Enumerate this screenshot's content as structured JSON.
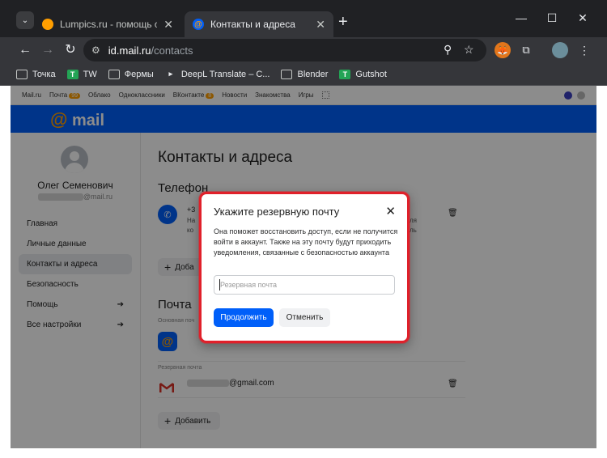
{
  "browser": {
    "tabs": [
      {
        "title": "Lumpics.ru - помощь с компь",
        "active": false
      },
      {
        "title": "Контакты и адреса",
        "active": true
      }
    ],
    "url_host": "id.mail.ru",
    "url_path": "/contacts",
    "bookmarks": [
      "Точка",
      "TW",
      "Фермы",
      "DeepL Translate – С...",
      "Blender",
      "Gutshot"
    ]
  },
  "portal_bar": {
    "items": [
      "Mail.ru",
      "Почта",
      "Облако",
      "Одноклассники",
      "ВКонтакте",
      "Новости",
      "Знакомства",
      "Игры"
    ],
    "mail_badge": "99",
    "vk_badge": "8"
  },
  "header": {
    "logo_at": "@",
    "logo_text": "mail"
  },
  "sidebar": {
    "user_name": "Олег Семенович",
    "user_email_suffix": "@mail.ru",
    "items": [
      {
        "label": "Главная",
        "active": false
      },
      {
        "label": "Личные данные",
        "active": false
      },
      {
        "label": "Контакты и адреса",
        "active": true
      },
      {
        "label": "Безопасность",
        "active": false
      },
      {
        "label": "Помощь",
        "active": false,
        "arrow": "➔"
      },
      {
        "label": "Все настройки",
        "active": false,
        "arrow": "➔"
      }
    ]
  },
  "main": {
    "title": "Контакты и адреса",
    "phone_section": "Телефон",
    "phone_prefix": "+3",
    "phone_line1": "На",
    "phone_line2": "ко",
    "phone_right1": "ля",
    "phone_right2": "ль",
    "add_label": "Добавить",
    "add_label_cut": "Доба",
    "mail_section": "Почта",
    "primary_label": "Основная поч",
    "backup_label": "Резервная почта",
    "backup_email_suffix": "@gmail.com"
  },
  "dialog": {
    "title": "Укажите резервную почту",
    "close": "✕",
    "text": "Она поможет восстановить доступ, если не получится войти в аккаунт. Также на эту почту будут приходить уведомления, связанные с безопасностью аккаунта",
    "placeholder": "Резервная почта",
    "continue_label": "Продолжить",
    "cancel_label": "Отменить"
  }
}
